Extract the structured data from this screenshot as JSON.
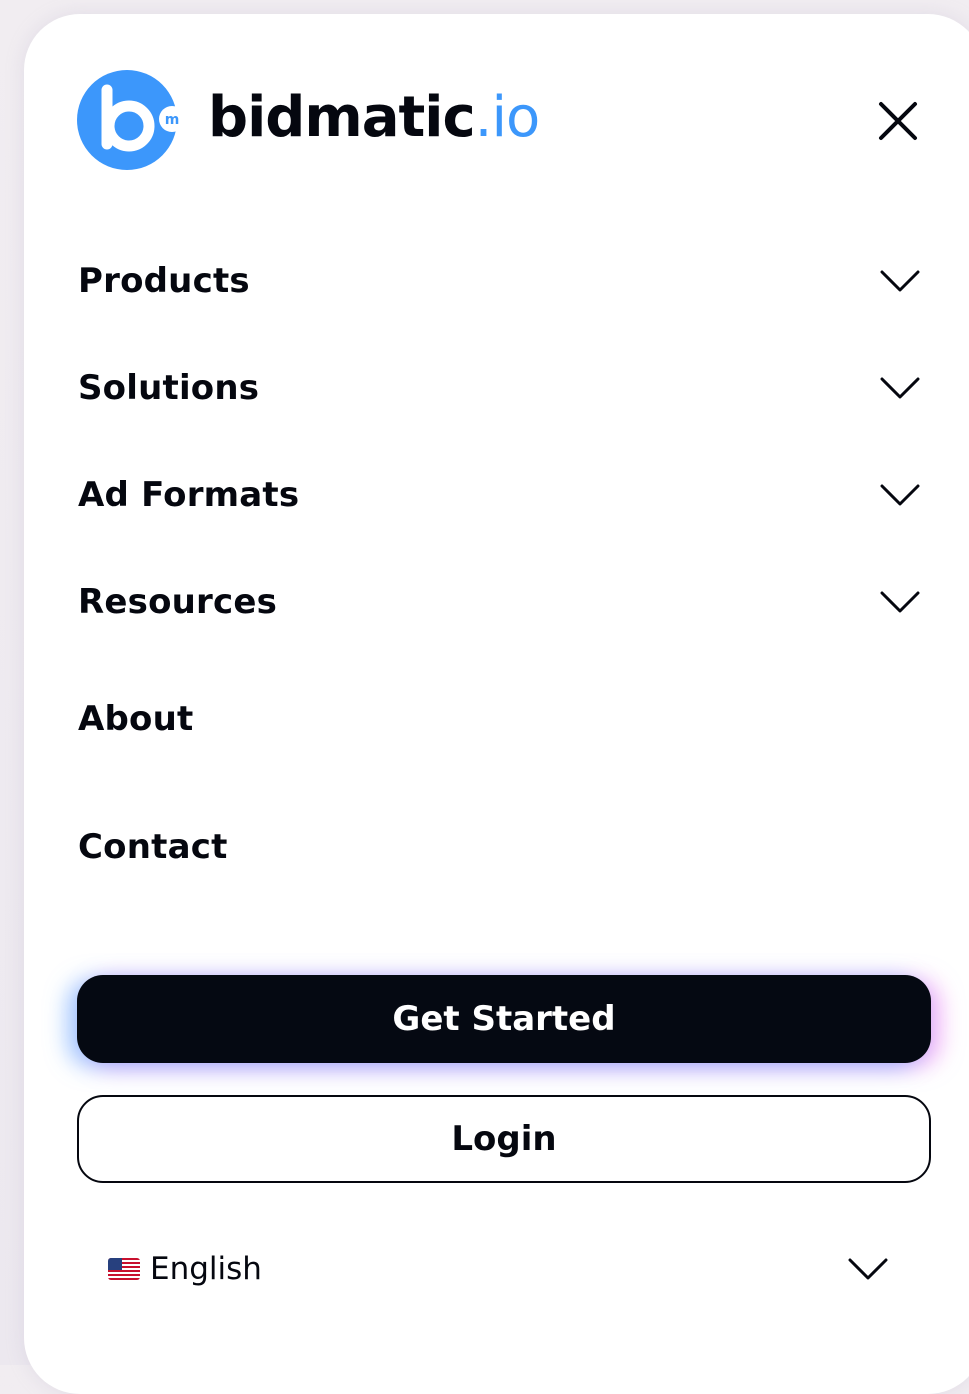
{
  "brand": {
    "name_main": "bidmatic",
    "name_suffix": ".io",
    "mark_letter": "b",
    "mark_sub": "m",
    "accent_color": "#3c97fb"
  },
  "header": {
    "close_icon": "close-icon"
  },
  "nav": {
    "items": [
      {
        "label": "Products",
        "has_submenu": true
      },
      {
        "label": "Solutions",
        "has_submenu": true
      },
      {
        "label": "Ad Formats",
        "has_submenu": true
      },
      {
        "label": "Resources",
        "has_submenu": true
      },
      {
        "label": "About",
        "has_submenu": false
      },
      {
        "label": "Contact",
        "has_submenu": false
      }
    ]
  },
  "actions": {
    "primary_label": "Get Started",
    "secondary_label": "Login"
  },
  "language": {
    "flag_icon": "us-flag-icon",
    "selected": "English"
  }
}
